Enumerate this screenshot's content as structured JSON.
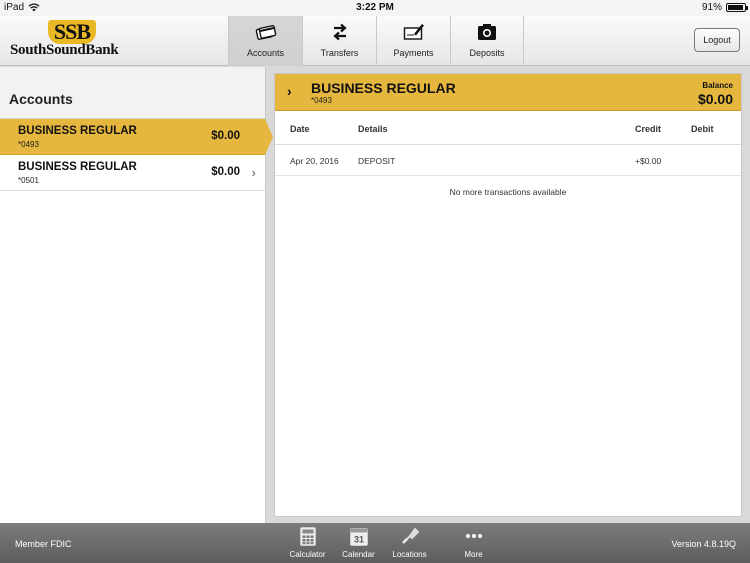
{
  "status_bar": {
    "device": "iPad",
    "time": "3:22 PM",
    "battery": "91%",
    "battery_level": 0.91
  },
  "header": {
    "logo_mark": "SSB",
    "logo_name": "SouthSoundBank",
    "tabs": [
      {
        "label": "Accounts",
        "icon": "credit-card-icon",
        "active": true
      },
      {
        "label": "Transfers",
        "icon": "transfer-arrows-icon",
        "active": false
      },
      {
        "label": "Payments",
        "icon": "check-pen-icon",
        "active": false
      },
      {
        "label": "Deposits",
        "icon": "camera-icon",
        "active": false
      }
    ],
    "logout_label": "Logout"
  },
  "accounts_panel": {
    "title": "Accounts",
    "accounts": [
      {
        "name": "BUSINESS REGULAR",
        "number": "*0493",
        "balance": "$0.00",
        "selected": true
      },
      {
        "name": "BUSINESS REGULAR",
        "number": "*0501",
        "balance": "$0.00",
        "selected": false
      }
    ]
  },
  "detail_panel": {
    "account_name": "BUSINESS REGULAR",
    "account_number": "*0493",
    "balance_label": "Balance",
    "balance_value": "$0.00",
    "columns": {
      "date": "Date",
      "details": "Details",
      "credit": "Credit",
      "debit": "Debit"
    },
    "transactions": [
      {
        "date": "Apr 20, 2016",
        "details": "DEPOSIT",
        "credit": "+$0.00",
        "debit": ""
      }
    ],
    "no_more_text": "No more transactions available"
  },
  "footer": {
    "member_fdic": "Member FDIC",
    "version": "Version 4.8.19Q",
    "tools": [
      {
        "label": "Calculator",
        "icon": "calculator-icon"
      },
      {
        "label": "Calendar",
        "icon": "calendar-icon",
        "calendar_day": "31"
      },
      {
        "label": "Locations",
        "icon": "map-pin-icon"
      },
      {
        "label": "More",
        "icon": "more-dots-icon"
      }
    ]
  },
  "colors": {
    "accent_gold": "#e6b73f",
    "logo_gold": "#e9b825",
    "footer_gray": "#6b6b6b"
  }
}
